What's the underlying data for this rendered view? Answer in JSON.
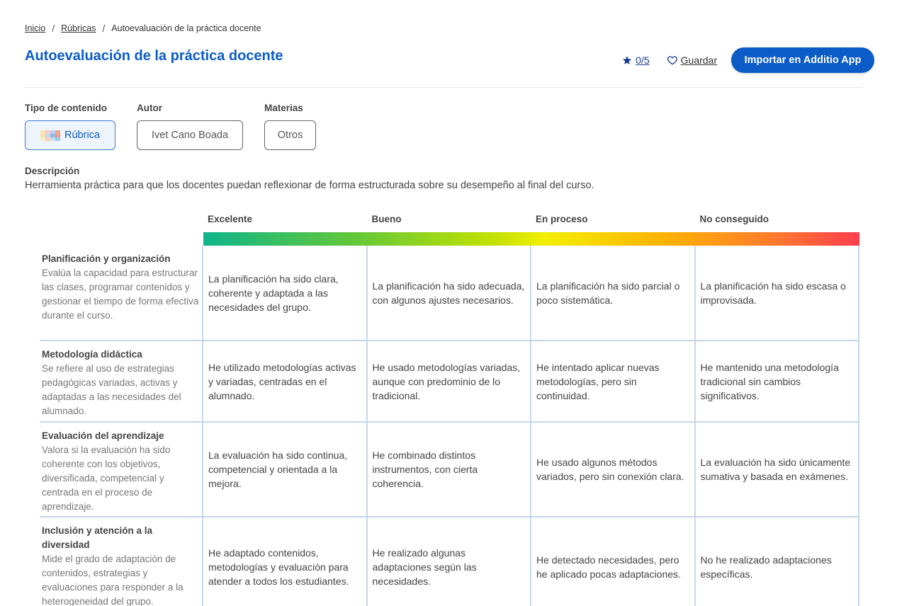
{
  "breadcrumb": {
    "home": "Inicio",
    "section": "Rúbricas",
    "current": "Autoevaluación de la práctica docente",
    "separator": "/"
  },
  "page": {
    "title": "Autoevaluación de la práctica docente",
    "rating": "0/5",
    "save_label": "Guardar",
    "import_label": "Importar en Additio App"
  },
  "meta": {
    "type_label": "Tipo de contenido",
    "type_value": "Rúbrica",
    "author_label": "Autor",
    "author_value": "Ivet Cano Boada",
    "subjects_label": "Materias",
    "subjects_value": "Otros"
  },
  "description": {
    "label": "Descripción",
    "text": "Herramienta práctica para que los docentes puedan reflexionar de forma estructurada sobre su desempeño al final del curso."
  },
  "levels": [
    "Excelente",
    "Bueno",
    "En proceso",
    "No conseguido"
  ],
  "criteria": [
    {
      "title": "Planificación y organización",
      "desc": "Evalúa la capacidad para estructurar las clases, programar contenidos y gestionar el tiempo de forma efectiva durante el curso.",
      "cells": [
        "La planificación ha sido clara, coherente y adaptada a las necesidades del grupo.",
        "La planificación ha sido adecuada, con algunos ajustes necesarios.",
        "La planificación ha sido parcial o poco sistemática.",
        "La planificación ha sido escasa o improvisada."
      ]
    },
    {
      "title": "Metodología didáctica",
      "desc": "Se refiere al uso de estrategias pedagógicas variadas, activas y adaptadas a las necesidades del alumnado.",
      "cells": [
        "He utilizado metodologías activas y variadas, centradas en el alumnado.",
        "He usado metodologías variadas, aunque con predominio de lo tradicional.",
        "He intentado aplicar nuevas metodologías, pero sin continuidad.",
        "He mantenido una metodología tradicional sin cambios significativos."
      ]
    },
    {
      "title": "Evaluación del aprendizaje",
      "desc": "Valora si la evaluación ha sido coherente con los objetivos, diversificada, competencial y centrada en el proceso de aprendizaje.",
      "cells": [
        "La evaluación ha sido continua, competencial y orientada a la mejora.",
        "He combinado distintos instrumentos, con cierta coherencia.",
        "He usado algunos métodos variados, pero sin conexión clara.",
        "La evaluación ha sido únicamente sumativa y basada en exámenes."
      ]
    },
    {
      "title": "Inclusión y atención a la diversidad",
      "desc": "Mide el grado de adaptación de contenidos, estrategias y evaluaciones para responder a la heterogeneidad del grupo.",
      "cells": [
        "He adaptado contenidos, metodologías y evaluación para atender a todos los estudiantes.",
        "He realizado algunas adaptaciones según las necesidades.",
        "He detectado necesidades, pero he aplicado pocas adaptaciones.",
        "No he realizado adaptaciones específicas."
      ]
    }
  ],
  "colors": {
    "primary": "#0b5cc7",
    "gradient_start": "#10b58a",
    "gradient_mid": "#f3ef00",
    "gradient_end": "#ff3d4e",
    "grid_border": "#c4d7ee"
  }
}
